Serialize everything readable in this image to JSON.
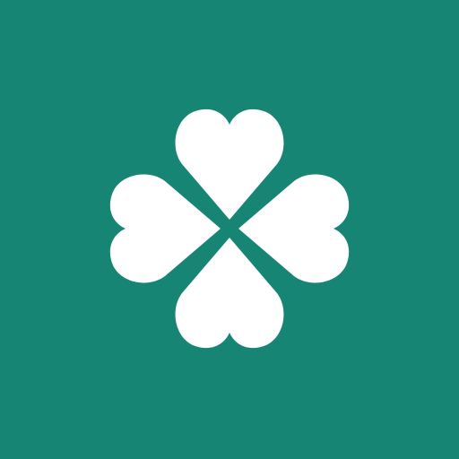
{
  "icon": {
    "name": "four-leaf-clover-icon",
    "background_color": "#178574",
    "foreground_color": "#ffffff"
  }
}
